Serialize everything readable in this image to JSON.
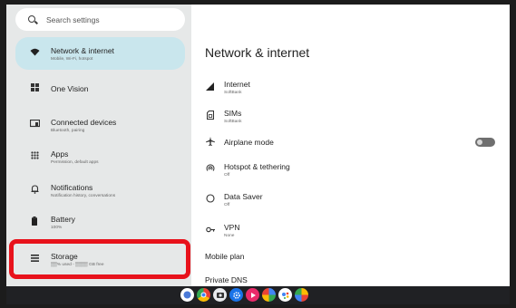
{
  "search": {
    "placeholder": "Search settings"
  },
  "sidebar": {
    "items": [
      {
        "label": "Network & internet",
        "sub": "Mobile, Wi-Fi, hotspot",
        "icon": "wifi-icon"
      },
      {
        "label": "One Vision",
        "sub": "",
        "icon": "grid-icon"
      },
      {
        "label": "Connected devices",
        "sub": "Bluetooth, pairing",
        "icon": "devices-icon"
      },
      {
        "label": "Apps",
        "sub": "Permission, default apps",
        "icon": "apps-icon"
      },
      {
        "label": "Notifications",
        "sub": "Notification history, conversations",
        "icon": "bell-icon"
      },
      {
        "label": "Battery",
        "sub": "100%",
        "icon": "battery-icon"
      },
      {
        "label": "Storage",
        "sub": "▒▒% used - ▒▒▒▒ GB free",
        "icon": "storage-icon"
      }
    ]
  },
  "main": {
    "title": "Network & internet",
    "rows": [
      {
        "label": "Internet",
        "sub": "SoftBank",
        "icon": "signal-icon"
      },
      {
        "label": "SIMs",
        "sub": "SoftBank",
        "icon": "sim-icon"
      },
      {
        "label": "Airplane mode",
        "sub": "",
        "icon": "airplane-icon"
      },
      {
        "label": "Hotspot & tethering",
        "sub": "Off",
        "icon": "hotspot-icon"
      },
      {
        "label": "Data Saver",
        "sub": "Off",
        "icon": "data-saver-icon"
      },
      {
        "label": "VPN",
        "sub": "None",
        "icon": "vpn-icon"
      },
      {
        "label": "Mobile plan",
        "sub": ""
      },
      {
        "label": "Private DNS",
        "sub": ""
      }
    ],
    "airplane_mode_on": false
  },
  "colors": {
    "active": "#c9e6ed",
    "highlight": "#e8121b",
    "sidebar_bg": "#e6e8e8"
  },
  "taskbar": {
    "apps": [
      "launcher-icon",
      "chrome-icon",
      "camera-icon",
      "settings-icon",
      "photos-icon",
      "play-store-icon",
      "assistant-icon",
      "gallery-icon"
    ]
  }
}
